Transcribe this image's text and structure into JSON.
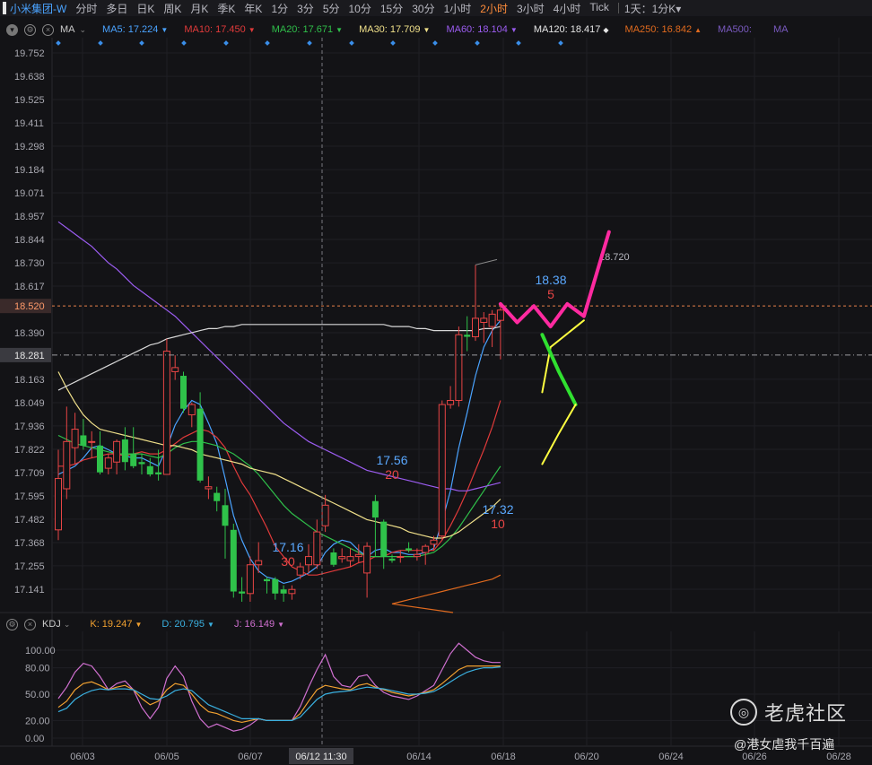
{
  "header": {
    "symbol": "小米集团-W",
    "timeframes": [
      "分时",
      "多日",
      "日K",
      "周K",
      "月K",
      "季K",
      "年K",
      "1分",
      "3分",
      "5分",
      "10分",
      "15分",
      "30分",
      "1小时",
      "2小时",
      "3小时",
      "4小时",
      "Tick"
    ],
    "active_timeframe": "2小时",
    "range_label": "1天：1分K",
    "range_caret": "▾"
  },
  "ma_bar": {
    "label": "MA",
    "caret": "⌄",
    "items": [
      {
        "name": "MA5:",
        "value": "17.224",
        "arrow": "▼",
        "color": "#4aa3ff"
      },
      {
        "name": "MA10:",
        "value": "17.450",
        "arrow": "▼",
        "color": "#e03a3a"
      },
      {
        "name": "MA20:",
        "value": "17.671",
        "arrow": "▼",
        "color": "#2fbf4a"
      },
      {
        "name": "MA30:",
        "value": "17.709",
        "arrow": "▼",
        "color": "#f0e08a"
      },
      {
        "name": "MA60:",
        "value": "18.104",
        "arrow": "▼",
        "color": "#9b5cf0"
      },
      {
        "name": "MA120:",
        "value": "18.417",
        "arrow": "◆",
        "color": "#e6e6e6"
      },
      {
        "name": "MA250:",
        "value": "16.842",
        "arrow": "▲",
        "color": "#e06a1e"
      },
      {
        "name": "MA500:",
        "value": "",
        "arrow": "",
        "color": "#7a5ac0"
      },
      {
        "name": "MA",
        "value": "",
        "arrow": "",
        "color": "#7a5ac0"
      }
    ]
  },
  "price_axis": {
    "ticks": [
      "19.752",
      "19.638",
      "19.525",
      "19.411",
      "19.298",
      "19.184",
      "19.071",
      "18.957",
      "18.844",
      "18.730",
      "18.617",
      "18.520",
      "18.390",
      "18.281",
      "18.163",
      "18.049",
      "17.936",
      "17.822",
      "17.709",
      "17.595",
      "17.482",
      "17.368",
      "17.255",
      "17.141"
    ],
    "current_price": "18.520",
    "crosshair_price": "18.281"
  },
  "annotations": {
    "high_label": "18.720",
    "labels": [
      {
        "price": "18.38",
        "count": "5"
      },
      {
        "price": "17.56",
        "count": "20"
      },
      {
        "price": "17.32",
        "count": "10"
      },
      {
        "price": "17.16",
        "count": "30"
      }
    ]
  },
  "kdj_bar": {
    "label": "KDJ",
    "caret": "⌄",
    "items": [
      {
        "name": "K:",
        "value": "19.247",
        "arrow": "▼",
        "color": "#f0a030"
      },
      {
        "name": "D:",
        "value": "20.795",
        "arrow": "▼",
        "color": "#3ab0e0"
      },
      {
        "name": "J:",
        "value": "16.149",
        "arrow": "▼",
        "color": "#d070d0"
      }
    ]
  },
  "kdj_axis": {
    "ticks": [
      "100.00",
      "80.00",
      "50.00",
      "20.00",
      "0.00"
    ]
  },
  "date_axis": {
    "ticks": [
      "06/03",
      "06/05",
      "06/07",
      "06/14",
      "06/18",
      "06/20",
      "06/24",
      "06/26",
      "06/28"
    ],
    "crosshair_time": "06/12 11:30"
  },
  "watermark": {
    "brand": "老虎社区",
    "author": "@港女虐我千百遍"
  },
  "chart_data": {
    "type": "candlestick",
    "title": "",
    "ylim": [
      17.06,
      19.81
    ],
    "candles": [
      {
        "o": 17.43,
        "h": 17.82,
        "l": 17.38,
        "c": 17.68
      },
      {
        "o": 17.63,
        "h": 18.03,
        "l": 17.58,
        "c": 17.86
      },
      {
        "o": 17.83,
        "h": 18.0,
        "l": 17.75,
        "c": 17.92
      },
      {
        "o": 17.89,
        "h": 17.97,
        "l": 17.82,
        "c": 17.84
      },
      {
        "o": 17.86,
        "h": 17.91,
        "l": 17.78,
        "c": 17.86
      },
      {
        "o": 17.84,
        "h": 17.91,
        "l": 17.7,
        "c": 17.71
      },
      {
        "o": 17.73,
        "h": 17.8,
        "l": 17.7,
        "c": 17.78
      },
      {
        "o": 17.76,
        "h": 17.87,
        "l": 17.7,
        "c": 17.86
      },
      {
        "o": 17.87,
        "h": 17.93,
        "l": 17.72,
        "c": 17.76
      },
      {
        "o": 17.8,
        "h": 17.93,
        "l": 17.73,
        "c": 17.74
      },
      {
        "o": 17.76,
        "h": 17.8,
        "l": 17.7,
        "c": 17.75
      },
      {
        "o": 17.74,
        "h": 17.78,
        "l": 17.69,
        "c": 17.7
      },
      {
        "o": 17.71,
        "h": 17.82,
        "l": 17.67,
        "c": 17.7
      },
      {
        "o": 17.7,
        "h": 18.36,
        "l": 17.71,
        "c": 18.3
      },
      {
        "o": 18.2,
        "h": 18.28,
        "l": 18.16,
        "c": 18.22
      },
      {
        "o": 18.18,
        "h": 18.2,
        "l": 18.0,
        "c": 18.02
      },
      {
        "o": 17.99,
        "h": 18.05,
        "l": 17.93,
        "c": 18.04
      },
      {
        "o": 18.02,
        "h": 18.1,
        "l": 17.66,
        "c": 17.67
      },
      {
        "o": 17.63,
        "h": 17.69,
        "l": 17.58,
        "c": 17.64
      },
      {
        "o": 17.61,
        "h": 17.64,
        "l": 17.52,
        "c": 17.57
      },
      {
        "o": 17.55,
        "h": 17.63,
        "l": 17.29,
        "c": 17.45
      },
      {
        "o": 17.43,
        "h": 17.46,
        "l": 17.1,
        "c": 17.13
      },
      {
        "o": 17.13,
        "h": 17.2,
        "l": 17.08,
        "c": 17.12
      },
      {
        "o": 17.12,
        "h": 17.3,
        "l": 17.08,
        "c": 17.26
      },
      {
        "o": 17.26,
        "h": 17.37,
        "l": 17.22,
        "c": 17.28
      },
      {
        "o": 17.19,
        "h": 17.2,
        "l": 17.12,
        "c": 17.18
      },
      {
        "o": 17.19,
        "h": 17.2,
        "l": 17.09,
        "c": 17.12
      },
      {
        "o": 17.14,
        "h": 17.16,
        "l": 17.08,
        "c": 17.12
      },
      {
        "o": 17.12,
        "h": 17.16,
        "l": 17.09,
        "c": 17.14
      },
      {
        "o": 17.21,
        "h": 17.27,
        "l": 17.19,
        "c": 17.25
      },
      {
        "o": 17.26,
        "h": 17.36,
        "l": 17.22,
        "c": 17.3
      },
      {
        "o": 17.26,
        "h": 17.48,
        "l": 17.24,
        "c": 17.42
      },
      {
        "o": 17.45,
        "h": 17.6,
        "l": 17.42,
        "c": 17.55
      },
      {
        "o": 17.32,
        "h": 17.34,
        "l": 17.25,
        "c": 17.26
      },
      {
        "o": 17.29,
        "h": 17.34,
        "l": 17.27,
        "c": 17.3
      },
      {
        "o": 17.28,
        "h": 17.34,
        "l": 17.25,
        "c": 17.3
      },
      {
        "o": 17.3,
        "h": 17.36,
        "l": 17.27,
        "c": 17.31
      },
      {
        "o": 17.22,
        "h": 17.37,
        "l": 17.1,
        "c": 17.35
      },
      {
        "o": 17.57,
        "h": 17.6,
        "l": 17.3,
        "c": 17.49
      },
      {
        "o": 17.47,
        "h": 17.48,
        "l": 17.24,
        "c": 17.3
      },
      {
        "o": 17.29,
        "h": 17.31,
        "l": 17.27,
        "c": 17.28
      },
      {
        "o": 17.3,
        "h": 17.33,
        "l": 17.27,
        "c": 17.3
      },
      {
        "o": 17.34,
        "h": 17.37,
        "l": 17.32,
        "c": 17.33
      },
      {
        "o": 17.3,
        "h": 17.34,
        "l": 17.28,
        "c": 17.31
      },
      {
        "o": 17.32,
        "h": 17.36,
        "l": 17.26,
        "c": 17.35
      },
      {
        "o": 17.36,
        "h": 17.4,
        "l": 17.33,
        "c": 17.38
      },
      {
        "o": 17.4,
        "h": 18.06,
        "l": 17.38,
        "c": 18.04
      },
      {
        "o": 18.04,
        "h": 18.13,
        "l": 18.02,
        "c": 18.06
      },
      {
        "o": 18.06,
        "h": 18.42,
        "l": 18.03,
        "c": 18.38
      },
      {
        "o": 18.38,
        "h": 18.47,
        "l": 18.3,
        "c": 18.37
      },
      {
        "o": 18.37,
        "h": 18.72,
        "l": 18.35,
        "c": 18.46
      },
      {
        "o": 18.44,
        "h": 18.49,
        "l": 18.34,
        "c": 18.46
      },
      {
        "o": 18.42,
        "h": 18.5,
        "l": 18.32,
        "c": 18.48
      },
      {
        "o": 18.45,
        "h": 18.52,
        "l": 18.26,
        "c": 18.5
      }
    ],
    "ma_series": [
      {
        "name": "MA5",
        "color": "#4aa3ff",
        "values": [
          17.7,
          17.72,
          17.74,
          17.78,
          17.83,
          17.84,
          17.82,
          17.8,
          17.79,
          17.78,
          17.78,
          17.76,
          17.74,
          17.83,
          17.94,
          18.01,
          18.06,
          18.04,
          17.95,
          17.85,
          17.68,
          17.5,
          17.38,
          17.29,
          17.23,
          17.2,
          17.19,
          17.17,
          17.18,
          17.2,
          17.22,
          17.25,
          17.32,
          17.36,
          17.38,
          17.37,
          17.33,
          17.3,
          17.33,
          17.34,
          17.32,
          17.32,
          17.31,
          17.31,
          17.32,
          17.34,
          17.47,
          17.62,
          17.83,
          18.0,
          18.18,
          18.32,
          18.4,
          18.45
        ]
      },
      {
        "name": "MA10",
        "color": "#e03a3a",
        "values": [
          17.74,
          17.74,
          17.75,
          17.77,
          17.78,
          17.79,
          17.8,
          17.8,
          17.79,
          17.8,
          17.81,
          17.8,
          17.8,
          17.82,
          17.85,
          17.88,
          17.9,
          17.92,
          17.91,
          17.88,
          17.83,
          17.74,
          17.66,
          17.6,
          17.52,
          17.44,
          17.35,
          17.3,
          17.25,
          17.23,
          17.21,
          17.21,
          17.22,
          17.23,
          17.24,
          17.25,
          17.27,
          17.28,
          17.3,
          17.3,
          17.32,
          17.33,
          17.33,
          17.33,
          17.33,
          17.33,
          17.38,
          17.45,
          17.53,
          17.62,
          17.72,
          17.82,
          17.93,
          18.06
        ]
      },
      {
        "name": "MA20",
        "color": "#2fbf4a",
        "values": [
          17.89,
          17.87,
          17.85,
          17.84,
          17.83,
          17.82,
          17.81,
          17.8,
          17.8,
          17.8,
          17.8,
          17.79,
          17.78,
          17.8,
          17.83,
          17.85,
          17.86,
          17.86,
          17.85,
          17.84,
          17.82,
          17.8,
          17.77,
          17.74,
          17.7,
          17.65,
          17.6,
          17.55,
          17.51,
          17.48,
          17.45,
          17.42,
          17.4,
          17.38,
          17.36,
          17.34,
          17.32,
          17.3,
          17.3,
          17.3,
          17.3,
          17.3,
          17.3,
          17.3,
          17.31,
          17.32,
          17.35,
          17.39,
          17.44,
          17.5,
          17.56,
          17.62,
          17.68,
          17.74
        ]
      },
      {
        "name": "MA30",
        "color": "#f0e08a",
        "values": [
          18.2,
          18.12,
          18.05,
          17.99,
          17.95,
          17.92,
          17.91,
          17.9,
          17.89,
          17.88,
          17.87,
          17.86,
          17.85,
          17.84,
          17.84,
          17.83,
          17.82,
          17.8,
          17.79,
          17.78,
          17.77,
          17.76,
          17.75,
          17.73,
          17.72,
          17.71,
          17.7,
          17.68,
          17.66,
          17.64,
          17.62,
          17.6,
          17.58,
          17.56,
          17.54,
          17.52,
          17.5,
          17.48,
          17.47,
          17.46,
          17.45,
          17.44,
          17.42,
          17.41,
          17.4,
          17.39,
          17.39,
          17.4,
          17.42,
          17.45,
          17.48,
          17.51,
          17.54,
          17.58
        ]
      },
      {
        "name": "MA60",
        "color": "#9b5cf0",
        "values": [
          18.93,
          18.9,
          18.87,
          18.84,
          18.81,
          18.77,
          18.73,
          18.7,
          18.66,
          18.62,
          18.59,
          18.56,
          18.53,
          18.5,
          18.47,
          18.43,
          18.39,
          18.35,
          18.31,
          18.27,
          18.23,
          18.19,
          18.15,
          18.11,
          18.07,
          18.03,
          17.99,
          17.95,
          17.92,
          17.89,
          17.86,
          17.84,
          17.82,
          17.8,
          17.78,
          17.76,
          17.74,
          17.72,
          17.71,
          17.7,
          17.69,
          17.68,
          17.67,
          17.66,
          17.65,
          17.64,
          17.63,
          17.63,
          17.62,
          17.62,
          17.63,
          17.64,
          17.65,
          17.66
        ]
      },
      {
        "name": "MA120",
        "color": "#d8d8d8",
        "values": [
          18.11,
          18.13,
          18.15,
          18.17,
          18.19,
          18.21,
          18.23,
          18.25,
          18.27,
          18.29,
          18.31,
          18.33,
          18.34,
          18.36,
          18.37,
          18.38,
          18.39,
          18.4,
          18.41,
          18.41,
          18.42,
          18.42,
          18.43,
          18.43,
          18.43,
          18.43,
          18.43,
          18.43,
          18.43,
          18.43,
          18.43,
          18.43,
          18.43,
          18.43,
          18.43,
          18.43,
          18.43,
          18.43,
          18.43,
          18.43,
          18.42,
          18.42,
          18.42,
          18.41,
          18.41,
          18.4,
          18.4,
          18.4,
          18.4,
          18.4,
          18.4,
          18.41,
          18.41,
          18.42
        ]
      },
      {
        "name": "MA250",
        "color": "#e06a1e",
        "values": [
          null,
          null,
          null,
          null,
          null,
          null,
          null,
          null,
          null,
          null,
          null,
          null,
          null,
          null,
          null,
          null,
          null,
          null,
          null,
          null,
          null,
          null,
          null,
          null,
          null,
          null,
          null,
          null,
          null,
          null,
          null,
          null,
          null,
          null,
          null,
          null,
          null,
          null,
          null,
          null,
          17.07,
          17.08,
          17.09,
          17.1,
          17.11,
          17.12,
          17.13,
          17.14,
          17.15,
          17.16,
          17.17,
          17.18,
          17.19,
          17.21
        ]
      }
    ],
    "kdj": {
      "K": [
        35,
        42,
        55,
        62,
        64,
        60,
        55,
        58,
        60,
        55,
        45,
        38,
        42,
        55,
        62,
        60,
        50,
        38,
        30,
        28,
        24,
        20,
        18,
        20,
        22,
        20,
        20,
        20,
        20,
        28,
        42,
        55,
        60,
        58,
        56,
        55,
        60,
        62,
        58,
        55,
        52,
        50,
        48,
        50,
        52,
        55,
        62,
        70,
        78,
        82,
        82,
        82,
        82,
        82
      ],
      "D": [
        30,
        34,
        44,
        50,
        54,
        56,
        55,
        56,
        56,
        55,
        50,
        45,
        44,
        48,
        54,
        56,
        54,
        46,
        38,
        34,
        30,
        26,
        22,
        22,
        22,
        20,
        20,
        20,
        20,
        24,
        34,
        44,
        50,
        52,
        53,
        54,
        56,
        58,
        57,
        56,
        54,
        52,
        50,
        50,
        51,
        53,
        58,
        64,
        70,
        75,
        78,
        80,
        80,
        81
      ],
      "J": [
        45,
        58,
        75,
        85,
        82,
        70,
        55,
        62,
        65,
        55,
        35,
        22,
        35,
        68,
        82,
        70,
        42,
        22,
        12,
        16,
        12,
        8,
        10,
        15,
        22,
        20,
        20,
        20,
        20,
        36,
        58,
        78,
        95,
        70,
        60,
        58,
        70,
        72,
        60,
        52,
        48,
        46,
        44,
        48,
        54,
        60,
        78,
        96,
        108,
        100,
        92,
        88,
        86,
        86
      ]
    },
    "projection": {
      "magenta": [
        [
          18.53,
          53
        ],
        [
          18.44,
          55
        ],
        [
          18.52,
          57
        ],
        [
          18.42,
          59
        ],
        [
          18.53,
          61
        ],
        [
          18.47,
          63
        ],
        [
          18.88,
          66
        ]
      ],
      "yellow": [
        [
          18.45,
          63
        ],
        [
          18.32,
          59
        ],
        [
          18.1,
          58
        ]
      ],
      "green": [
        [
          18.38,
          58
        ],
        [
          18.2,
          60
        ],
        [
          18.04,
          62
        ]
      ],
      "yellow_lower": [
        [
          17.75,
          58
        ],
        [
          17.9,
          60
        ],
        [
          18.04,
          62
        ]
      ]
    }
  }
}
